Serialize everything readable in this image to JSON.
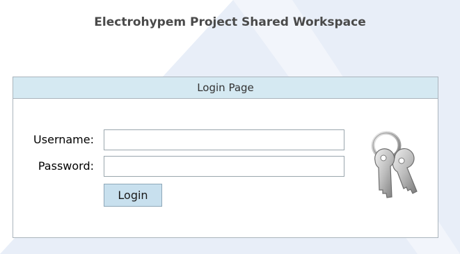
{
  "page": {
    "title": "Electrohypem Project Shared Workspace"
  },
  "login": {
    "header": "Login Page",
    "username_label": "Username:",
    "username_value": "",
    "password_label": "Password:",
    "password_value": "",
    "login_button": "Login",
    "icon": "keys-icon"
  },
  "colors": {
    "header_bg": "#d5e9f2",
    "button_bg": "#c8e0ee",
    "background_shape": "#e6edf8"
  }
}
